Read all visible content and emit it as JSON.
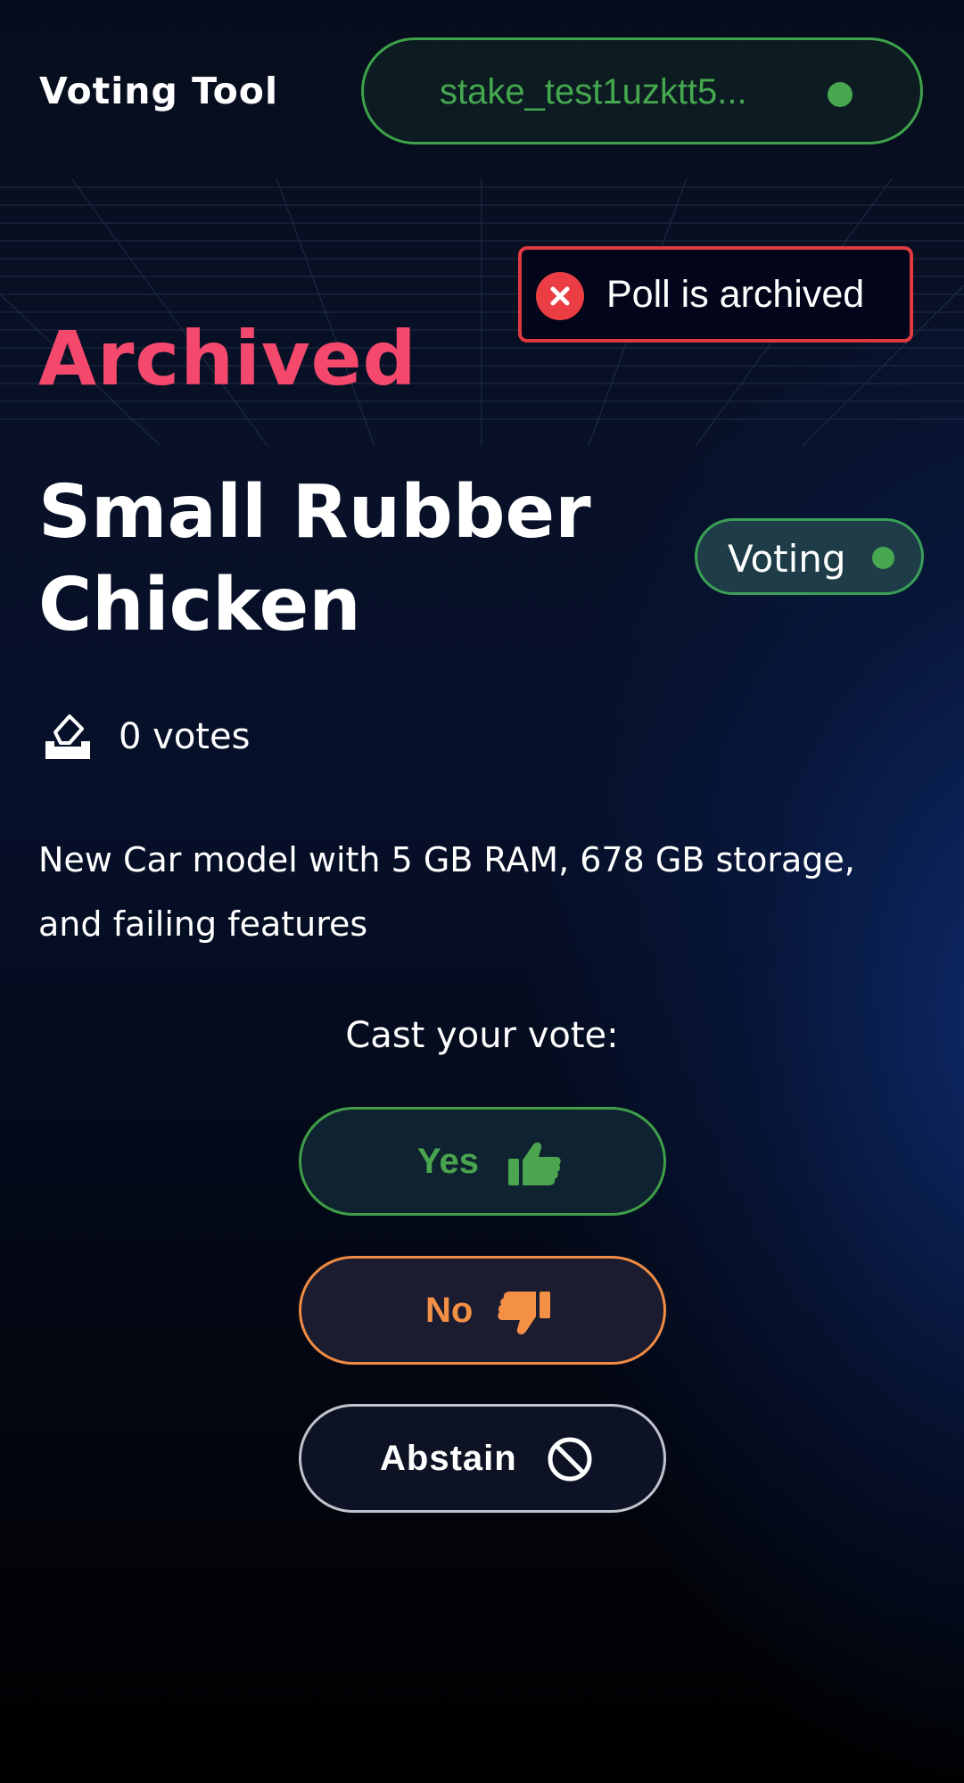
{
  "header": {
    "app_title": "Voting Tool",
    "wallet_address": "stake_test1uzktt5...",
    "wallet_status_color": "#48a850"
  },
  "toast": {
    "message": "Poll is archived",
    "icon": "close-circle-icon",
    "color": "#e03a3e"
  },
  "poll": {
    "state_label": "Archived",
    "title": "Small Rubber Chicken",
    "status": "Voting",
    "votes_text": "0 votes",
    "votes_icon": "ballot-box-icon",
    "description": "New Car model with 5 GB RAM, 678 GB storage, and failing features"
  },
  "voting": {
    "prompt": "Cast your vote:",
    "options": [
      {
        "label": "Yes",
        "icon": "thumbs-up-icon",
        "color": "#4aa54e"
      },
      {
        "label": "No",
        "icon": "thumbs-down-icon",
        "color": "#f39046"
      },
      {
        "label": "Abstain",
        "icon": "ban-icon",
        "color": "#ffffff"
      }
    ]
  },
  "colors": {
    "archived": "#f4496c",
    "accent_green": "#3ea24a",
    "background": "#070d1c"
  }
}
